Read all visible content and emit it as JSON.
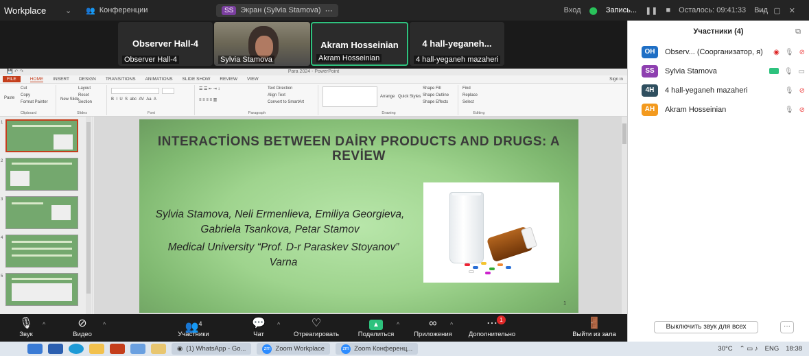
{
  "topbar": {
    "app_title": "Workplace",
    "meeting": "Конференции",
    "screen_badge": "SS",
    "screen_label": "Экран (Sylvia Stamova)",
    "login": "Вход",
    "record": "Запись...",
    "remaining": "Осталось: 09:41:33",
    "view": "Вид"
  },
  "videos": [
    {
      "name": "Observer Hall-4",
      "sub": "Observer Hall-4"
    },
    {
      "name": "",
      "sub": "Sylvia Stamova"
    },
    {
      "name": "Akram Hosseinian",
      "sub": "Akram Hosseinian"
    },
    {
      "name": "4  hall-yeganeh...",
      "sub": "4 hall-yeganeh mazaheri"
    }
  ],
  "ppt": {
    "window_title": "Para 2024 - PowerPoint",
    "tabs": [
      "FILE",
      "HOME",
      "INSERT",
      "DESIGN",
      "TRANSITIONS",
      "ANIMATIONS",
      "SLIDE SHOW",
      "REVIEW",
      "VIEW"
    ],
    "sign_in": "Sign in",
    "ribbon": {
      "clipboard": {
        "label": "Clipboard",
        "cut": "Cut",
        "copy": "Copy",
        "paste": "Paste",
        "format_painter": "Format Painter"
      },
      "slides": {
        "label": "Slides",
        "new_slide": "New Slide",
        "layout": "Layout",
        "reset": "Reset",
        "section": "Section"
      },
      "font": {
        "label": "Font"
      },
      "paragraph": {
        "label": "Paragraph",
        "text_direction": "Text Direction",
        "align_text": "Align Text",
        "smartart": "Convert to SmartArt"
      },
      "drawing": {
        "label": "Drawing",
        "arrange": "Arrange",
        "quick_styles": "Quick Styles",
        "shape_fill": "Shape Fill",
        "shape_outline": "Shape Outline",
        "shape_effects": "Shape Effects"
      },
      "editing": {
        "label": "Editing",
        "find": "Find",
        "replace": "Replace",
        "select": "Select"
      }
    },
    "slide_numbers": [
      "1",
      "2",
      "3",
      "4",
      "5"
    ],
    "slide": {
      "title": "INTERACTİONS BETWEEN DAİRY PRODUCTS AND DRUGS: A REVİEW",
      "authors": "Sylvia Stamova, Neli Ermenlieva, Emiliya Georgieva, Gabriela Tsankova, Petar Stamov",
      "affiliation": "Medical University “Prof. D-r Paraskev Stoyanov” Varna",
      "number": "1"
    }
  },
  "toolbar": {
    "audio": "Звук",
    "video": "Видео",
    "participants": "Участники",
    "participants_count": "4",
    "chat": "Чат",
    "react": "Отреагировать",
    "share": "Поделиться",
    "apps": "Приложения",
    "more": "Дополнительно",
    "more_badge": "1",
    "leave": "Выйти из зала"
  },
  "panel": {
    "title": "Участники (4)",
    "participants": [
      {
        "initials": "OH",
        "name": "Observ...  (Соорганизатор, я)",
        "color": "#1f6fc5"
      },
      {
        "initials": "SS",
        "name": "Sylvia Stamova",
        "color": "#8e3fb0"
      },
      {
        "initials": "4H",
        "name": "4 hall-yeganeh mazaheri",
        "color": "#2f4f5f"
      },
      {
        "initials": "AH",
        "name": "Akram Hosseinian",
        "color": "#f39a1e"
      }
    ],
    "mute_all": "Выключить звук для всех",
    "more": "···"
  },
  "taskbar": {
    "apps": [
      {
        "label": "(1) WhatsApp - Go..."
      },
      {
        "label": "Zoom Workplace"
      },
      {
        "label": "Zoom Конференц..."
      }
    ],
    "temperature": "30°C",
    "lang": "ENG",
    "time": "18:38"
  },
  "colors": {
    "zoom_green": "#2ec27e",
    "ppt_accent": "#c43e1c",
    "slide_green": "#9fd48e"
  }
}
